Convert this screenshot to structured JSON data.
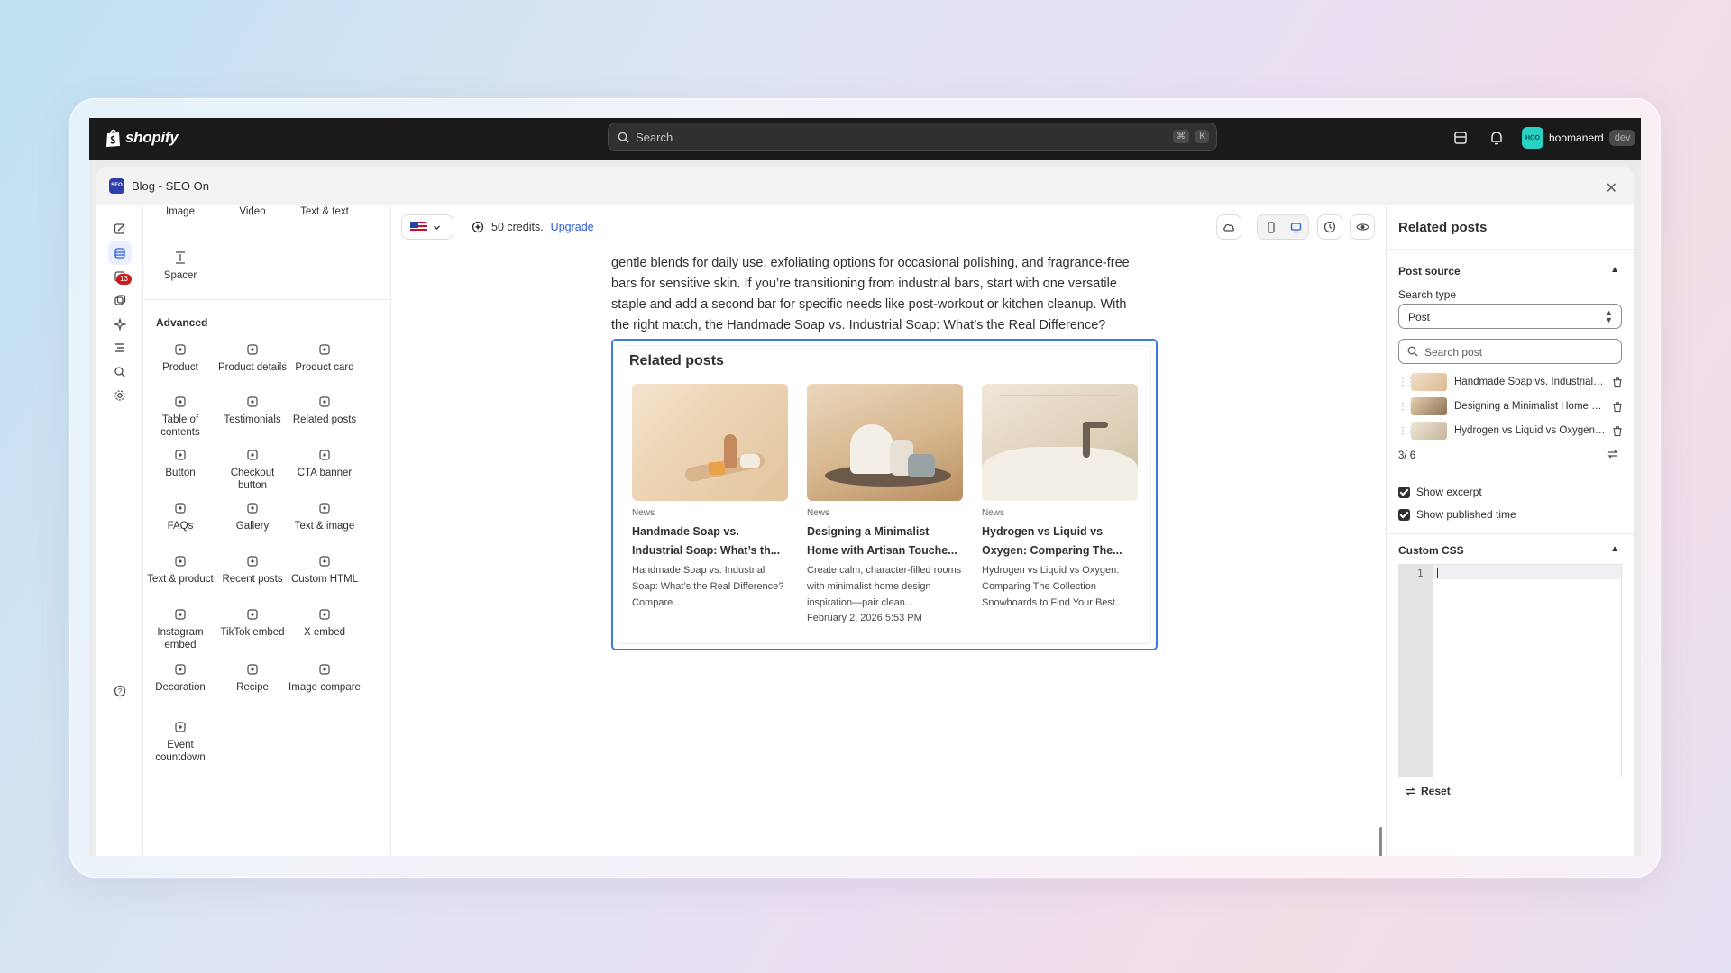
{
  "topbar": {
    "logo_text": "shopify",
    "search_placeholder": "Search",
    "shortcut_cmd": "⌘",
    "shortcut_key": "K",
    "user_initials": "HOO",
    "user_name": "hoomanerd",
    "user_badge": "dev"
  },
  "app": {
    "logo_text": "SEO",
    "title": "Blog - SEO On"
  },
  "rail": {
    "badge_count": "13"
  },
  "blocks": {
    "top_items": [
      "Image",
      "Video",
      "Text & text",
      "Spacer"
    ],
    "advanced_title": "Advanced",
    "advanced_items": [
      [
        "Product",
        "Product details",
        "Product card"
      ],
      [
        "Table of contents",
        "Testimonials",
        "Related posts"
      ],
      [
        "Button",
        "Checkout button",
        "CTA banner"
      ],
      [
        "FAQs",
        "Gallery",
        "Text & image"
      ],
      [
        "Text & product",
        "Recent posts",
        "Custom HTML"
      ],
      [
        "Instagram embed",
        "TikTok embed",
        "X embed"
      ],
      [
        "Decoration",
        "Recipe",
        "Image compare"
      ],
      [
        "Event countdown"
      ]
    ]
  },
  "toolbar": {
    "credits_text": "50 credits.",
    "upgrade_label": "Upgrade"
  },
  "article": {
    "paragraph": "gentle blends for daily use, exfoliating options for occasional polishing, and fragrance-free bars for sensitive skin. If you’re transitioning from industrial bars, start with one versatile staple and add a second bar for specific needs like post-workout or kitchen cleanup. With the right match, the Handmade Soap vs. Industrial Soap: What’s the Real Difference? question becomes less confusing and more personal."
  },
  "related_posts": {
    "title": "Related posts",
    "cards": [
      {
        "tag": "News",
        "title": "Handmade Soap vs. Industrial Soap: What’s th...",
        "excerpt": "Handmade Soap vs. Industrial Soap: What’s the Real Difference? Compare...",
        "date": ""
      },
      {
        "tag": "News",
        "title": "Designing a Minimalist Home with Artisan Touche...",
        "excerpt": "Create calm, character-filled rooms with minimalist home design inspiration—pair clean...",
        "date": "February 2, 2026 5:53 PM"
      },
      {
        "tag": "News",
        "title": "Hydrogen vs Liquid vs Oxygen: Comparing The...",
        "excerpt": "Hydrogen vs Liquid vs Oxygen: Comparing The Collection Snowboards to Find Your Best...",
        "date": ""
      }
    ]
  },
  "settings": {
    "title": "Related posts",
    "post_source_title": "Post source",
    "search_type_label": "Search type",
    "search_type_value": "Post",
    "search_placeholder": "Search post",
    "posts": [
      "Handmade Soap vs. Industrial Soap: What’s the Real Difference?",
      "Designing a Minimalist Home with Artisan Touches",
      "Hydrogen vs Liquid vs Oxygen: Comparing The Collection"
    ],
    "count": "3/ 6",
    "show_excerpt_label": "Show excerpt",
    "show_published_label": "Show published time",
    "custom_css_title": "Custom CSS",
    "line_number": "1",
    "reset_label": "Reset"
  },
  "colors": {
    "accent": "#2b5ad3",
    "selection_border": "#3c7dd9",
    "topbar_bg": "#1a1a1a"
  }
}
